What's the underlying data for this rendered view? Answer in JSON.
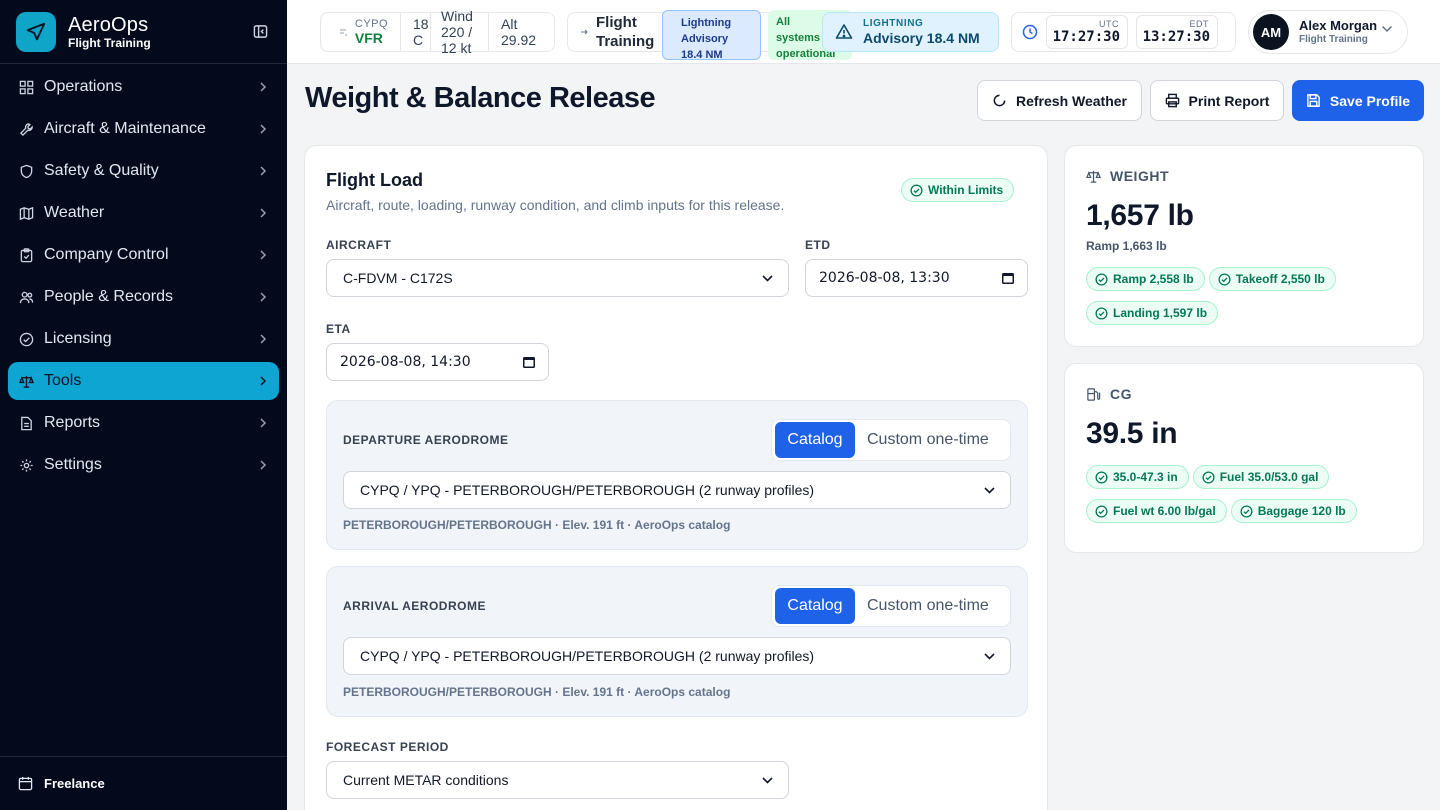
{
  "brand": {
    "name": "AeroOps",
    "subtitle": "Flight Training"
  },
  "sidebar": {
    "items": [
      {
        "label": "Operations",
        "icon": "grid-icon"
      },
      {
        "label": "Aircraft & Maintenance",
        "icon": "wrench-icon"
      },
      {
        "label": "Safety & Quality",
        "icon": "shield-icon"
      },
      {
        "label": "Weather",
        "icon": "map-icon"
      },
      {
        "label": "Company Control",
        "icon": "clipboard-icon"
      },
      {
        "label": "People & Records",
        "icon": "people-icon"
      },
      {
        "label": "Licensing",
        "icon": "check-circle-icon"
      },
      {
        "label": "Tools",
        "icon": "scale-icon",
        "active": true
      },
      {
        "label": "Reports",
        "icon": "document-icon"
      },
      {
        "label": "Settings",
        "icon": "gear-icon"
      }
    ],
    "footer": "Freelance"
  },
  "topbar": {
    "weather": {
      "station": "CYPQ",
      "category": "VFR",
      "temp_1": "18",
      "temp_2": "C",
      "wind_1": "Wind",
      "wind_2": "220 /",
      "wind_3": "12 kt",
      "alt_1": "Alt",
      "alt_2": "29.92"
    },
    "flight_training": {
      "label_1": "Flight",
      "label_2": "Training",
      "lightning_1": "Lightning",
      "lightning_2": "Advisory",
      "lightning_3": "18.4 NM",
      "status_1": "All",
      "status_2": "systems",
      "status_3": "operational"
    },
    "advisory": {
      "kind": "LIGHTNING",
      "text": "Advisory 18.4 NM"
    },
    "clock": {
      "utc_label": "UTC",
      "utc_time": "17:27:30",
      "local_label": "EDT",
      "local_time": "13:27:30"
    },
    "user": {
      "initials": "AM",
      "name": "Alex Morgan",
      "role": "Flight Training"
    }
  },
  "page": {
    "title": "Weight & Balance Release",
    "actions": {
      "refresh": "Refresh Weather",
      "print": "Print Report",
      "save": "Save Profile"
    }
  },
  "flight_load": {
    "title": "Flight Load",
    "subtitle": "Aircraft, route, loading, runway condition, and climb inputs for this release.",
    "status": "Within Limits",
    "aircraft_label": "AIRCRAFT",
    "aircraft_value": "C-FDVM - C172S",
    "etd_label": "ETD",
    "etd_value": "2026-08-08, 13:30",
    "eta_label": "ETA",
    "eta_value": "2026-08-08, 14:30",
    "departure": {
      "label": "DEPARTURE AERODROME",
      "mode_catalog": "Catalog",
      "mode_custom": "Custom one-time",
      "value": "CYPQ / YPQ - PETERBOROUGH/PETERBOROUGH (2 runway profiles)",
      "note": "PETERBOROUGH/PETERBOROUGH · Elev. 191 ft · AeroOps catalog"
    },
    "arrival": {
      "label": "ARRIVAL AERODROME",
      "mode_catalog": "Catalog",
      "mode_custom": "Custom one-time",
      "value": "CYPQ / YPQ - PETERBOROUGH/PETERBOROUGH (2 runway profiles)",
      "note": "PETERBOROUGH/PETERBOROUGH · Elev. 191 ft · AeroOps catalog"
    },
    "forecast_label": "FORECAST PERIOD",
    "forecast_value": "Current METAR conditions"
  },
  "weight": {
    "label": "WEIGHT",
    "value": "1,657 lb",
    "ramp": "Ramp 1,663 lb",
    "pills": [
      "Ramp 2,558 lb",
      "Takeoff 2,550 lb",
      "Landing 1,597 lb"
    ]
  },
  "cg": {
    "label": "CG",
    "value": "39.5 in",
    "pills": [
      "35.0-47.3 in",
      "Fuel 35.0/53.0 gal",
      "Fuel wt 6.00 lb/gal",
      "Baggage 120 lb"
    ]
  },
  "colors": {
    "accent": "#0ea5d2",
    "primary": "#1d62e8",
    "ok": "#047857"
  }
}
